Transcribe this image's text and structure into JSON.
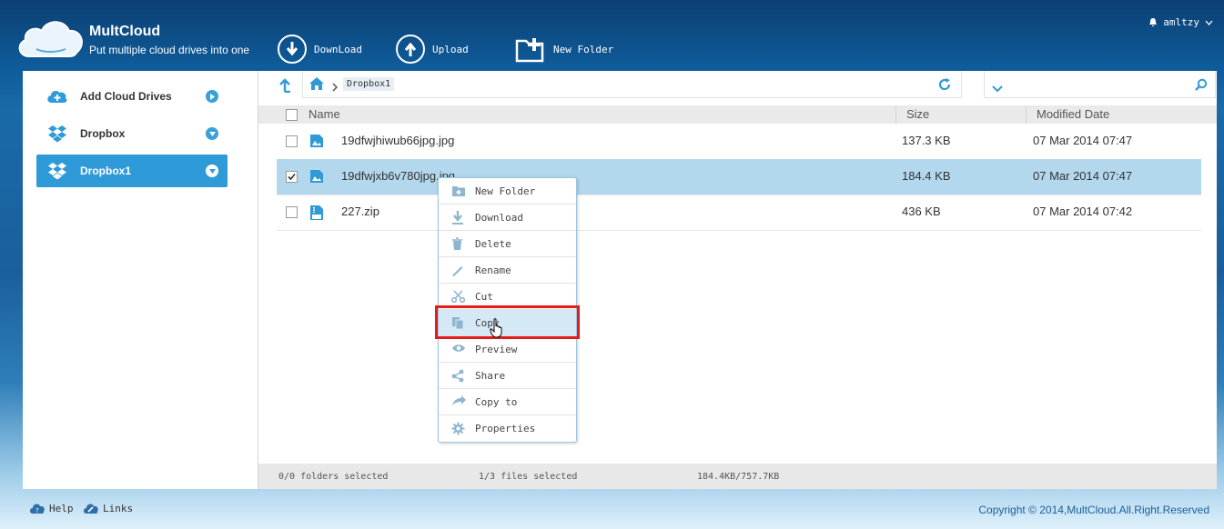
{
  "header": {
    "brand": "MultCloud",
    "tagline": "Put multiple cloud drives into one",
    "toolbar": [
      {
        "label": "DownLoad",
        "icon": "download-icon"
      },
      {
        "label": "Upload",
        "icon": "upload-icon"
      },
      {
        "label": "New Folder",
        "icon": "new-folder-icon"
      }
    ],
    "user": "amltzy"
  },
  "sidebar": {
    "items": [
      {
        "label": "Add Cloud Drives",
        "icon": "add-cloud-icon"
      },
      {
        "label": "Dropbox",
        "icon": "dropbox-icon"
      },
      {
        "label": "Dropbox1",
        "icon": "dropbox-icon",
        "active": true
      }
    ]
  },
  "pathbar": {
    "crumb": "Dropbox1"
  },
  "table": {
    "headers": {
      "name": "Name",
      "size": "Size",
      "date": "Modified Date"
    },
    "rows": [
      {
        "name": "19dfwjhiwub66jpg.jpg",
        "size": "137.3 KB",
        "date": "07 Mar 2014 07:47",
        "selected": false
      },
      {
        "name": "19dfwjxb6v780jpg.jpg",
        "size": "184.4 KB",
        "date": "07 Mar 2014 07:47",
        "selected": true
      },
      {
        "name": "227.zip",
        "size": "436 KB",
        "date": "07 Mar 2014 07:42",
        "selected": false
      }
    ]
  },
  "status": {
    "folders": "0/0 folders selected",
    "files": "1/3 files selected",
    "size": "184.4KB/757.7KB"
  },
  "context_menu": {
    "items": [
      {
        "label": "New Folder",
        "icon": "new-folder-icon"
      },
      {
        "label": "Download",
        "icon": "download-icon"
      },
      {
        "label": "Delete",
        "icon": "trash-icon"
      },
      {
        "label": "Rename",
        "icon": "pencil-icon"
      },
      {
        "label": "Cut",
        "icon": "scissors-icon"
      },
      {
        "label": "Copy",
        "icon": "copy-icon"
      },
      {
        "label": "Preview",
        "icon": "eye-icon"
      },
      {
        "label": "Share",
        "icon": "share-icon"
      },
      {
        "label": "Copy to",
        "icon": "copy-to-icon"
      },
      {
        "label": "Properties",
        "icon": "gear-icon"
      }
    ]
  },
  "footer": {
    "help": "Help",
    "links": "Links",
    "copyright": "Copyright © 2014,MultCloud.All.Right.Reserved"
  },
  "colors": {
    "accent": "#2f9ad8",
    "selected_row": "#b3d7ec",
    "highlight": "#e51b1b"
  }
}
